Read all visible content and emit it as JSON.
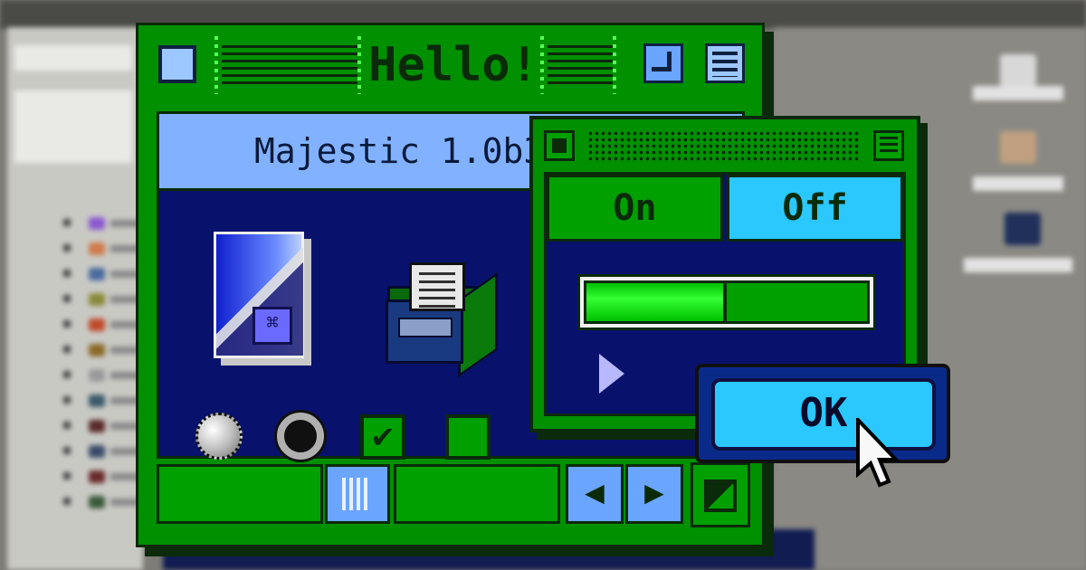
{
  "main_window": {
    "title": "Hello!",
    "version_label": "Majestic 1.0b3"
  },
  "control_panel": {
    "toggle_on_label": "On",
    "toggle_off_label": "Off",
    "active_toggle": "off",
    "slider_level": 0.5
  },
  "dialog": {
    "ok_label": "OK"
  },
  "colors": {
    "window_green": "#009000",
    "content_navy": "#08126c",
    "accent_blue": "#82b2ff",
    "ok_cyan": "#2ac8ff"
  },
  "icons": [
    "close-box-icon",
    "stripes-icon",
    "zoom-icon",
    "window-shade-icon",
    "document-icon",
    "file-cabinet-icon",
    "disclosure-triangle-icon",
    "arrow-left-icon",
    "arrow-right-icon",
    "resize-icon",
    "cursor-icon"
  ]
}
